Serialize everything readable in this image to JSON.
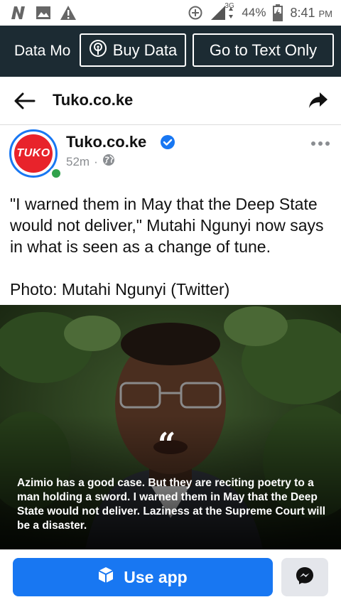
{
  "status_bar": {
    "battery": "44%",
    "network": "3G",
    "time": "8:41",
    "ampm": "PM"
  },
  "data_banner": {
    "data_mode_label": "Data Mo",
    "buy_data_label": "Buy Data",
    "text_only_label": "Go to Text Only"
  },
  "header": {
    "title": "Tuko.co.ke"
  },
  "post": {
    "page_name": "Tuko.co.ke",
    "avatar_text": "TUKO",
    "time_ago": "52m",
    "separator": "·",
    "text_paragraph_1": "\"I warned them in May that the Deep State would not deliver,\" Mutahi Ngunyi now says in what is seen as a change of tune.",
    "text_paragraph_2": "Photo: Mutahi Ngunyi (Twitter)",
    "image_quote_mark": "“",
    "image_quote": "Azimio has a good case. But they are reciting poetry to a man holding a sword. I warned them in May that the Deep State would not deliver. Laziness at the Supreme Court will be a disaster."
  },
  "bottom_bar": {
    "use_app_label": "Use app"
  },
  "colors": {
    "facebook_blue": "#1877f2",
    "banner_bg": "#1c2b33",
    "tuko_red": "#e8232b",
    "online_green": "#31a24c"
  },
  "icons": {
    "status_left": [
      "n-notification-icon",
      "image-icon",
      "warning-icon"
    ],
    "status_right": [
      "data-saver-icon",
      "signal-icon",
      "battery-icon"
    ],
    "header": [
      "back-arrow-icon",
      "share-icon"
    ],
    "post": [
      "verified-badge-icon",
      "globe-icon",
      "more-options-icon"
    ],
    "bottom": [
      "cube-icon",
      "messenger-icon"
    ]
  }
}
